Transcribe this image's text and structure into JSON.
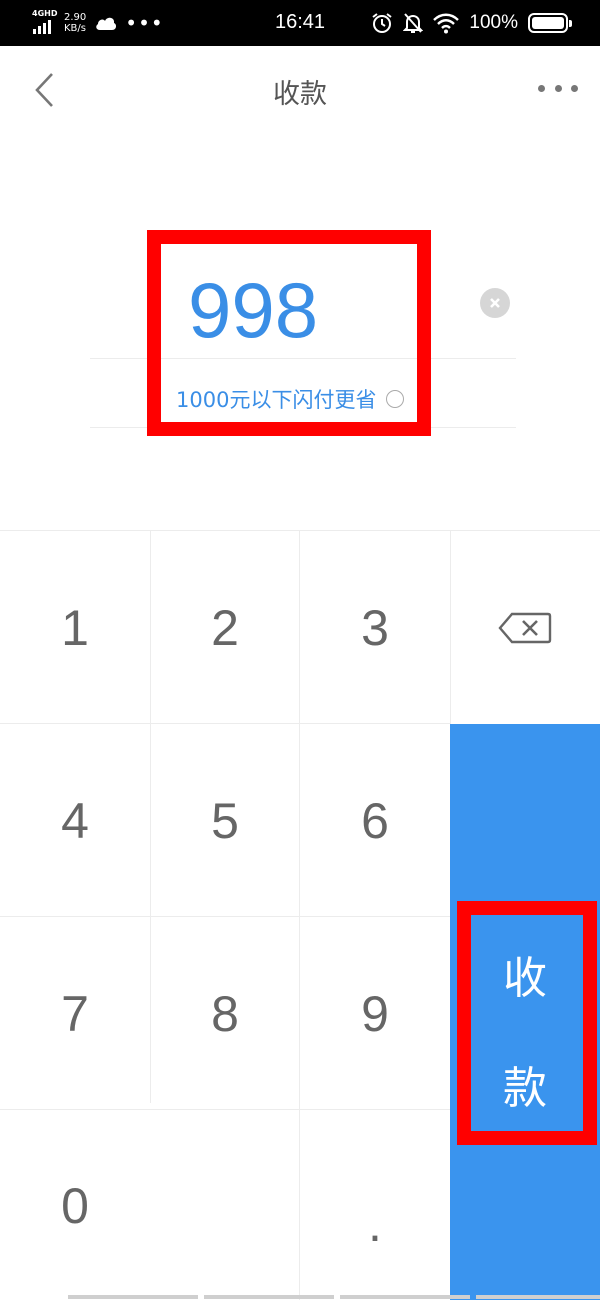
{
  "status_bar": {
    "network": "4GHD",
    "speed_value": "2.90",
    "speed_unit": "KB/s",
    "time": "16:41",
    "battery": "100%"
  },
  "nav": {
    "title": "收款",
    "back_icon": "chevron-left-icon",
    "more_icon": "more-dots-icon"
  },
  "amount": {
    "value": "998",
    "hint": "1000元以下闪付更省"
  },
  "keypad": {
    "keys": [
      "1",
      "2",
      "3",
      "4",
      "5",
      "6",
      "7",
      "8",
      "9",
      "0",
      "."
    ],
    "delete_icon": "backspace-icon",
    "submit_label": "收\n款"
  },
  "colors": {
    "accent": "#3a94ee",
    "amount_text": "#3a8ee6",
    "highlight": "#ff0000"
  }
}
